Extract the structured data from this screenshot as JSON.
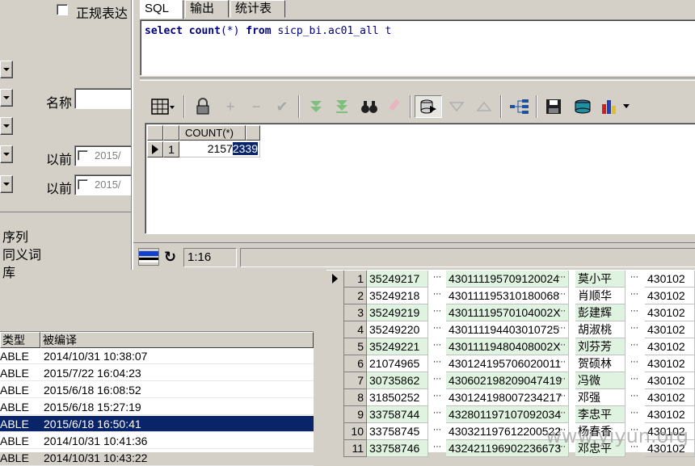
{
  "left_panel": {
    "regex_checkbox_label": "正规表达",
    "name_label": "名称",
    "before_label_1": "以前",
    "before_label_2": "以前",
    "date_1": "2015/",
    "date_2": "2015/",
    "object_types": [
      "序列",
      "同义词",
      "库"
    ]
  },
  "left_grid": {
    "headers": [
      "类型",
      "被编译"
    ],
    "rows": [
      {
        "type": "ABLE",
        "compiled": "2014/10/31 10:38:07"
      },
      {
        "type": "ABLE",
        "compiled": "2015/7/22 16:04:23"
      },
      {
        "type": "ABLE",
        "compiled": "2015/6/18 16:08:52"
      },
      {
        "type": "ABLE",
        "compiled": "2015/6/18 15:27:19"
      },
      {
        "type": "ABLE",
        "compiled": "2015/6/18 16:50:41"
      },
      {
        "type": "ABLE",
        "compiled": "2014/10/31 10:41:36"
      },
      {
        "type": "ABLE",
        "compiled": "2014/10/31 10:43:22"
      }
    ],
    "selected_index": 4
  },
  "sql_window": {
    "tabs": [
      "SQL",
      "输出",
      "统计表"
    ],
    "active_tab": 0,
    "query": {
      "kw1": "select",
      "fn": "count",
      "args": "(*)",
      "kw2": "from",
      "rest": "sicp_bi.ac01_all t"
    },
    "result": {
      "column": "COUNT(*)",
      "row_number": "1",
      "value_plain": "2157",
      "value_selected": "2339"
    },
    "status": {
      "cursor_position": "1:16"
    }
  },
  "toolbar_icons": [
    "grid-icon",
    "lock-icon",
    "plus-icon",
    "minus-icon",
    "check-icon",
    "next-record-icon",
    "last-record-icon",
    "find-icon",
    "clear-icon",
    "query-icon",
    "sort-up-icon",
    "sort-down-icon",
    "tree-icon",
    "save-icon",
    "database-icon",
    "chart-icon"
  ],
  "right_grid": {
    "rows": [
      {
        "n": "1",
        "id": "35249217",
        "idcard": "430111195709120024",
        "name": "莫小平",
        "code": "430102"
      },
      {
        "n": "2",
        "id": "35249218",
        "idcard": "430111195310180068",
        "name": "肖顺华",
        "code": "430102"
      },
      {
        "n": "3",
        "id": "35249219",
        "idcard": "43011119570104002X",
        "name": "彭建辉",
        "code": "430102"
      },
      {
        "n": "4",
        "id": "35249220",
        "idcard": "430111194403010725",
        "name": "胡淑桃",
        "code": "430102"
      },
      {
        "n": "5",
        "id": "35249221",
        "idcard": "43011119480408002X",
        "name": "刘芬芳",
        "code": "430102"
      },
      {
        "n": "6",
        "id": "21074965",
        "idcard": "430124195706020011",
        "name": "贺硕林",
        "code": "430102"
      },
      {
        "n": "7",
        "id": "30735862",
        "idcard": "430602198209047419",
        "name": "冯微",
        "code": "430102"
      },
      {
        "n": "8",
        "id": "31850252",
        "idcard": "430124198007234217",
        "name": "邓强",
        "code": "430102"
      },
      {
        "n": "9",
        "id": "33758744",
        "idcard": "432801197107092034",
        "name": "李忠平",
        "code": "430102"
      },
      {
        "n": "10",
        "id": "33758745",
        "idcard": "430321197612200522",
        "name": "杨春香",
        "code": "430102"
      },
      {
        "n": "11",
        "id": "33758746",
        "idcard": "432421196902236673",
        "name": "邓忠平",
        "code": "430102"
      }
    ]
  },
  "watermark": "www.yiyun.org"
}
